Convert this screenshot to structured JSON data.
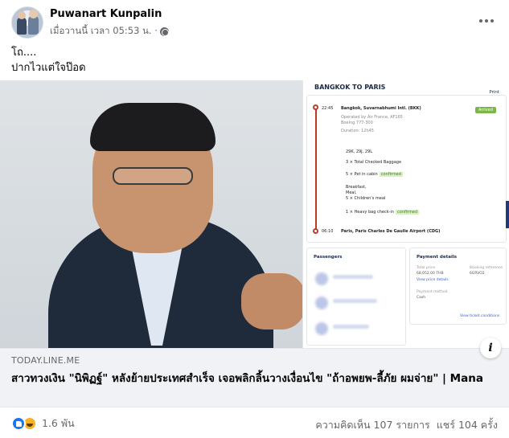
{
  "post": {
    "author": "Puwanart Kunpalin",
    "time_text": "เมื่อวานนี้ เวลา 05:53 น. ·",
    "privacy_icon": "globe-icon",
    "text_line1": "โถ....",
    "text_line2": "ปากไวแต่ใจป๊อด"
  },
  "link_card": {
    "domain": "TODAY.LINE.ME",
    "headline": "สาวทวงเงิน \"นิพิฏฐ์\" หลังย้ายประเทศสำเร็จ เจอพลิกลิ้นวางเงื่อนไข \"ถ้าอพยพ-ลี้ภัย ผมจ่าย\" | Mana",
    "info_icon": "i",
    "screenshot": {
      "title": "BANGKOK TO PARIS",
      "print": "Print",
      "depart_time": "22:45",
      "depart_place": "Bangkok, Suvarnabhumi Intl. (BKK)",
      "status": "Arrived",
      "operated": "Operated by Air France, AF165",
      "aircraft": "Boeing 777-300",
      "duration": "Duration: 12h45",
      "seats": "29K, 29J, 29L",
      "baggage": "3 × Total Checked Baggage",
      "cabin": "5 × Pet in cabin",
      "cabin_tag": "confirmed",
      "meal1": "Breakfast,",
      "meal2": "Meal,",
      "meal3": "5 × Children's meal",
      "checkin": "1 × Heavy bag check-in",
      "checkin_tag": "confirmed",
      "arrive_time": "06:10",
      "arrive_place": "Paris, Paris Charles De Gaulle Airport (CDG)",
      "passengers": "Passengers",
      "payment": "Payment details",
      "total_price_label": "Total price",
      "total_price": "68,052.00 THB",
      "booking_ref_label": "Booking reference",
      "booking_ref": "6GRVO2",
      "price_details": "View price details",
      "method_label": "Payment method",
      "method": "Cash",
      "conditions": "View ticket conditions"
    }
  },
  "footer": {
    "reaction_count": "1.6 พัน",
    "comments": "ความคิดเห็น 107 รายการ",
    "shares": "แชร์ 104 ครั้ง"
  }
}
